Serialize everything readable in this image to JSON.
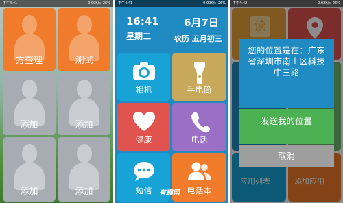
{
  "screen1": {
    "status": {
      "time": "下午4:41",
      "speed": "0.00K/s",
      "battery": "26%"
    },
    "tiles": [
      {
        "label": "方查理",
        "style": "orange"
      },
      {
        "label": "测试",
        "style": "orange"
      },
      {
        "label": "添加",
        "style": "gray"
      },
      {
        "label": "添加",
        "style": "gray"
      },
      {
        "label": "添加",
        "style": "gray"
      },
      {
        "label": "添加",
        "style": "gray"
      }
    ]
  },
  "screen2": {
    "status": {
      "time": "下午4:41",
      "speed": "0.00K/s",
      "battery": "26%"
    },
    "clock": {
      "time": "16:41",
      "weekday": "星期二",
      "date": "6月7日",
      "lunar": "农历 五月初三"
    },
    "apps": [
      {
        "label": "相机",
        "icon": "camera-icon",
        "color": "#17a3d6"
      },
      {
        "label": "手电筒",
        "icon": "flashlight-icon",
        "color": "#c8a85a"
      },
      {
        "label": "健康",
        "icon": "heart-icon",
        "color": "#e0534f"
      },
      {
        "label": "电话",
        "icon": "phone-icon",
        "color": "#9b6fc6"
      },
      {
        "label": "短信",
        "icon": "message-icon",
        "color": "#17a3d6"
      },
      {
        "label": "电话本",
        "icon": "contacts-icon",
        "color": "#f07b2b"
      }
    ],
    "watermark": "有趣网"
  },
  "screen3": {
    "status": {
      "time": "下午4:42",
      "speed": "0.02K/s",
      "battery": "26%"
    },
    "background_labels": {
      "app_list": "应用列表",
      "add_app": "添加应用",
      "read_glyph": "读"
    },
    "dialog": {
      "message": "您的位置是在：广东省深圳市南山区科技中三路",
      "send_button": "发送我的位置",
      "cancel_button": "取消"
    }
  }
}
